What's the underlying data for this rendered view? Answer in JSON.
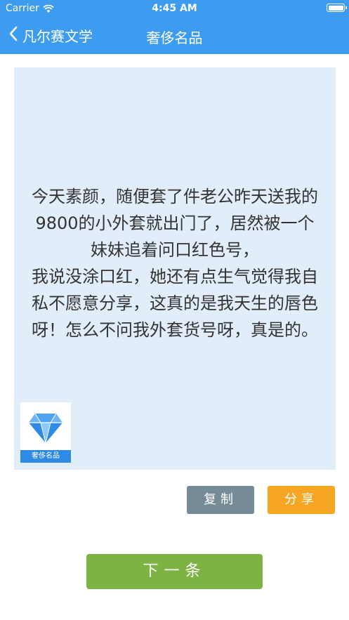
{
  "status_bar": {
    "carrier": "Carrier",
    "time": "4:45 AM",
    "battery_level": 1.0
  },
  "nav": {
    "back_label": "凡尔赛文学",
    "title": "奢侈名品"
  },
  "content": {
    "text": "今天素颜，随便套了件老公昨天送我的\n9800的小外套就出门了，居然被一个\n妹妹追着问口红色号，\n我说没涂口红，她还有点生气觉得我自\n私不愿意分享，这真的是我天生的唇色\n呀！怎么不问我外套货号呀，真是的。",
    "logo_caption": "奢侈名品",
    "logo_icon": "diamond-icon"
  },
  "actions": {
    "copy_label": "复制",
    "share_label": "分享",
    "next_label": "下一条"
  },
  "colors": {
    "nav_bg": "#3d9bf0",
    "card_bg": "#e1eef9",
    "copy_bg": "#758b96",
    "share_bg": "#f7a623",
    "next_bg": "#7cb342"
  }
}
